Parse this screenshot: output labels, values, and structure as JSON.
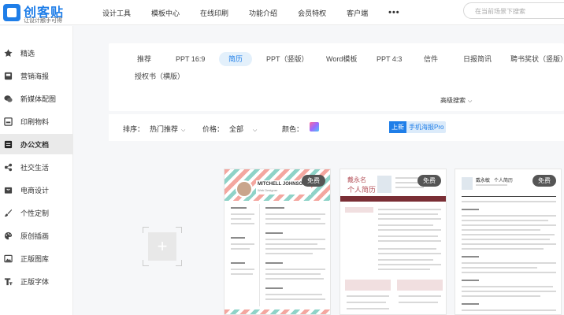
{
  "logo": {
    "title": "创客贴",
    "subtitle": "让设计触手可得"
  },
  "nav": {
    "items": [
      "设计工具",
      "模板中心",
      "在线印刷",
      "功能介绍",
      "会员特权",
      "客户端"
    ],
    "more": "•••",
    "search_placeholder": "在当前场景下搜索"
  },
  "sidebar": {
    "items": [
      {
        "label": "精选",
        "icon": "star-icon"
      },
      {
        "label": "营销海报",
        "icon": "poster-icon"
      },
      {
        "label": "新媒体配图",
        "icon": "chat-icon"
      },
      {
        "label": "印刷物料",
        "icon": "print-icon"
      },
      {
        "label": "办公文档",
        "icon": "document-icon",
        "active": true
      },
      {
        "label": "社交生活",
        "icon": "social-icon"
      },
      {
        "label": "电商设计",
        "icon": "shop-icon"
      },
      {
        "label": "个性定制",
        "icon": "brush-icon"
      },
      {
        "label": "原创插画",
        "icon": "palette-icon"
      },
      {
        "label": "正版图库",
        "icon": "image-icon"
      },
      {
        "label": "正版字体",
        "icon": "font-icon"
      }
    ]
  },
  "categories": {
    "tabs": [
      "推荐",
      "PPT 16:9",
      "简历",
      "PPT（竖版）",
      "Word模板",
      "PPT 4:3",
      "信件",
      "日报简讯",
      "聘书奖状（竖版）",
      "授权书（横版）"
    ],
    "active": "简历",
    "advanced": "高级搜索"
  },
  "filters": {
    "sort_label": "排序：",
    "sort_value": "热门推荐",
    "price_label": "价格：",
    "price_value": "全部",
    "color_label": "颜色：",
    "promo_tag": "上新",
    "promo_text": "手机海报Pro"
  },
  "cards": [
    {
      "badge": "免费",
      "name": "MITCHELL JOHNSON",
      "role": "Web Designer"
    },
    {
      "badge": "免费",
      "name": "戴永名",
      "title": "个人简历"
    },
    {
      "badge": "免费",
      "name": "戴永敏",
      "title": "个人简历"
    }
  ],
  "colors": {
    "accent": "#1f7ee8",
    "active_tab_bg": "#e3f0fb"
  }
}
